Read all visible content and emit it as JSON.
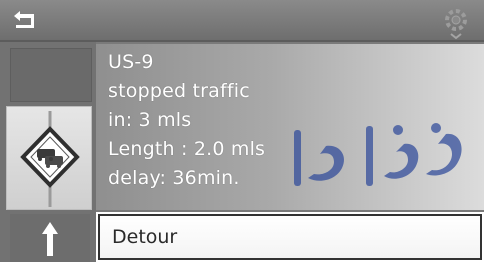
{
  "toolbar": {
    "back_icon": "return-arrow-icon",
    "settings_icon": "gear-icon"
  },
  "traffic_info": {
    "road": "US-9",
    "condition": "stopped traffic",
    "distance": "in: 3 mls",
    "length": "Length : 2.0 mls",
    "delay": "delay: 36min."
  },
  "left_panel": {
    "sign_icon": "traffic-jam-warning-icon",
    "arrow_icon": "arrow-up-icon"
  },
  "actions": {
    "detour_label": "Detour"
  },
  "watermark": {
    "text": "دوفارما"
  },
  "colors": {
    "header": "#7b7b7b",
    "info_text": "#ffffff",
    "watermark": "#2f4a9a",
    "button_border": "#333333"
  }
}
